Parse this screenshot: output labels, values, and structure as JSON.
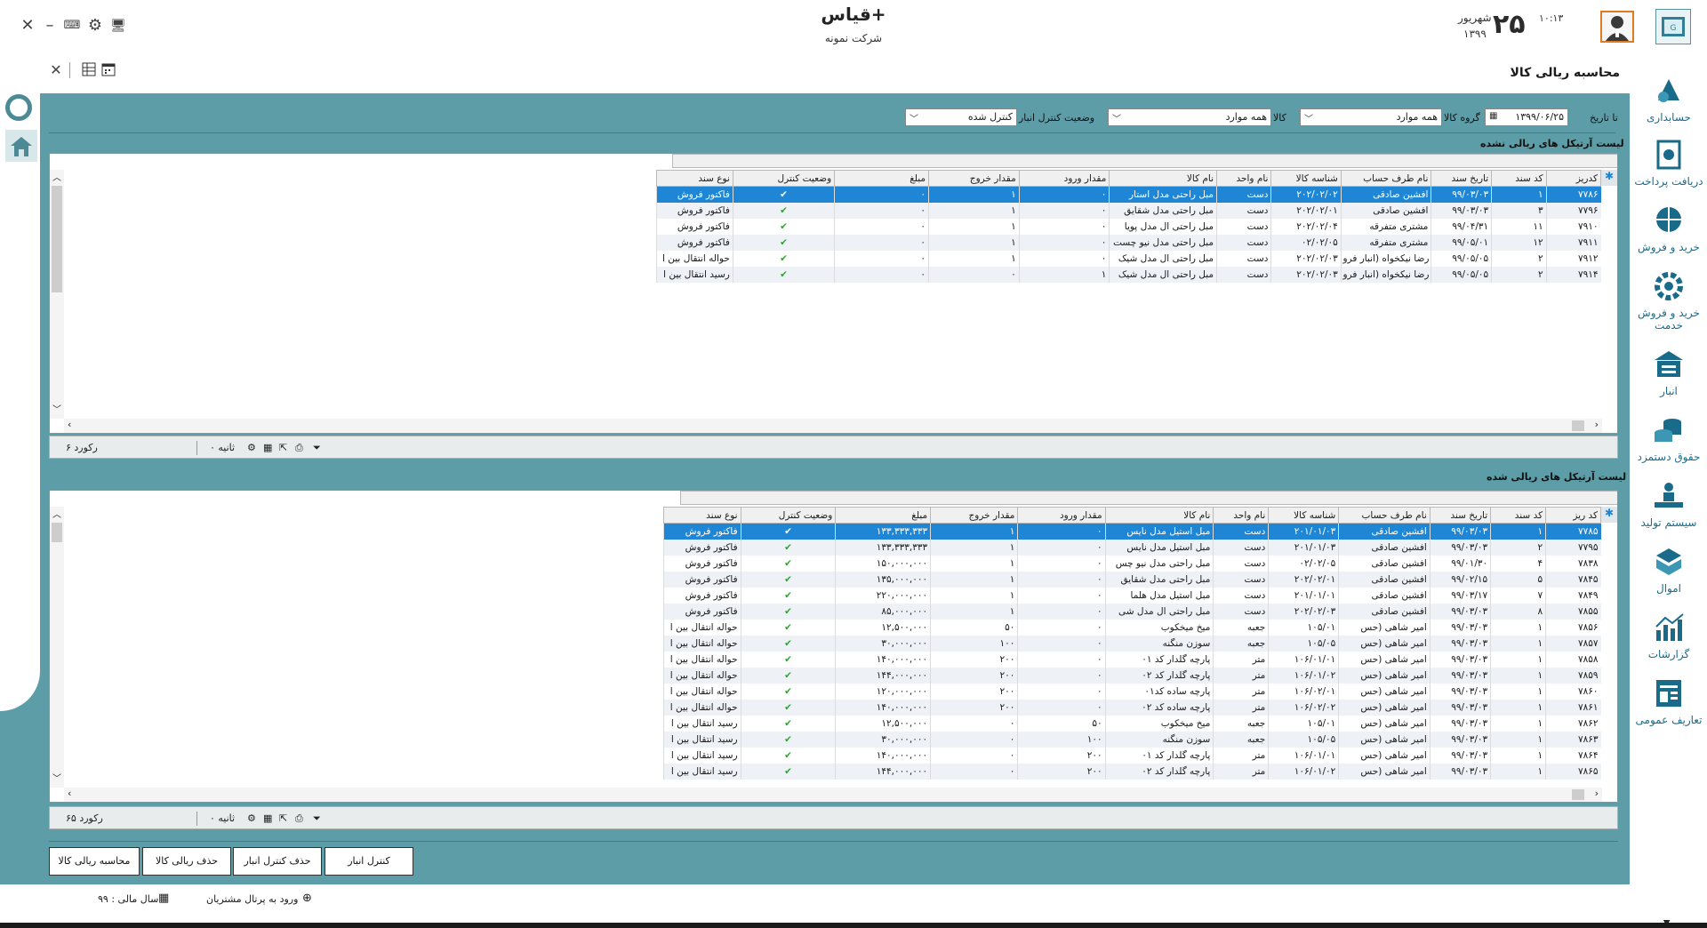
{
  "app": {
    "title": "قیاس+",
    "company": "شرکت نمونه",
    "date_day": "۲۵",
    "date_month": "شهریور",
    "date_year": "۱۳۹۹",
    "clock": "۱۰:۱۳"
  },
  "page": {
    "title": "محاسبه ریالی کالا"
  },
  "filters": {
    "to_date_label": "تا تاریخ",
    "to_date_value": "۱۳۹۹/۰۶/۲۵",
    "group_label": "گروه کالا",
    "group_value": "همه موارد",
    "item_label": "کالا",
    "item_value": "همه موارد",
    "status_label": "وضعیت کنترل انبار",
    "status_value": "کنترل شده"
  },
  "grid1": {
    "title": "لیست آرتیکل های ریالی نشده",
    "columns": [
      "کدریز",
      "کد سند",
      "تاریخ سند",
      "نام طرف حساب",
      "شناسه کالا",
      "نام واحد",
      "نام کالا",
      "مقدار ورود",
      "مقدار خروج",
      "مبلغ",
      "وضعیت کنترل",
      "نوع سند"
    ],
    "rows": [
      [
        "۷۷۸۶",
        "۱",
        "۹۹/۰۳/۰۳",
        "افشین صادقی",
        "۲۰۲/۰۲/۰۲",
        "دست",
        "مبل راحتی مدل استار",
        "۰",
        "۱",
        "۰",
        "✔",
        "فاکتور فروش"
      ],
      [
        "۷۷۹۶",
        "۳",
        "۹۹/۰۳/۰۳",
        "افشین صادقی",
        "۲۰۲/۰۲/۰۱",
        "دست",
        "مبل راحتی مدل شقایق",
        "۰",
        "۱",
        "۰",
        "✔",
        "فاکتور فروش"
      ],
      [
        "۷۹۱۰",
        "۱۱",
        "۹۹/۰۴/۳۱",
        "مشتری متفرقه",
        "۲۰۲/۰۲/۰۴",
        "دست",
        "مبل راحتی ال مدل پویا",
        "۰",
        "۱",
        "۰",
        "✔",
        "فاکتور فروش"
      ],
      [
        "۷۹۱۱",
        "۱۲",
        "۹۹/۰۵/۰۱",
        "مشتری متفرقه",
        "۰۲/۰۲/۰۵",
        "دست",
        "مبل راحتی مدل نیو چست",
        "۰",
        "۱",
        "۰",
        "✔",
        "فاکتور فروش"
      ],
      [
        "۷۹۱۲",
        "۲",
        "۹۹/۰۵/۰۵",
        "رضا نیکخواه (انبار فرو",
        "۲۰۲/۰۲/۰۳",
        "دست",
        "مبل راحتی ال مدل شیک",
        "۰",
        "۱",
        "۰",
        "✔",
        "حواله انتقال بین ا"
      ],
      [
        "۷۹۱۴",
        "۲",
        "۹۹/۰۵/۰۵",
        "رضا نیکخواه (انبار فرو",
        "۲۰۲/۰۲/۰۳",
        "دست",
        "مبل راحتی ال مدل شیک",
        "۱",
        "۰",
        "۰",
        "✔",
        "رسید انتقال بین ا"
      ]
    ],
    "record_count": "۶ رکورد",
    "timer": "۰ ثانیه"
  },
  "grid2": {
    "title": "لیست آرتیکل های ریالی شده",
    "columns": [
      "کد ریز",
      "کد سند",
      "تاریخ سند",
      "نام طرف حساب",
      "شناسه کالا",
      "نام واحد",
      "نام کالا",
      "مقدار ورود",
      "مقدار خروج",
      "مبلغ",
      "وضعیت کنترل",
      "نوع سند"
    ],
    "rows": [
      [
        "۷۷۸۵",
        "۱",
        "۹۹/۰۳/۰۳",
        "افشین صادقی",
        "۲۰۱/۰۱/۰۳",
        "دست",
        "مبل استیل مدل نایس",
        "۰",
        "۱",
        "۱۳۳,۳۳۳,۳۳۳",
        "✔",
        "فاکتور فروش"
      ],
      [
        "۷۷۹۵",
        "۲",
        "۹۹/۰۳/۰۳",
        "افشین صادقی",
        "۲۰۱/۰۱/۰۳",
        "دست",
        "مبل استیل مدل نایس",
        "۰",
        "۱",
        "۱۳۳,۳۳۳,۳۳۳",
        "✔",
        "فاکتور فروش"
      ],
      [
        "۷۸۳۸",
        "۴",
        "۹۹/۰۱/۳۰",
        "افشین صادقی",
        "۰۲/۰۲/۰۵",
        "دست",
        "مبل راحتی مدل نیو چس",
        "۰",
        "۱",
        "۱۵۰,۰۰۰,۰۰۰",
        "✔",
        "فاکتور فروش"
      ],
      [
        "۷۸۴۵",
        "۵",
        "۹۹/۰۲/۱۵",
        "افشین صادقی",
        "۲۰۲/۰۲/۰۱",
        "دست",
        "مبل راحتی مدل شقایق",
        "۰",
        "۱",
        "۱۳۵,۰۰۰,۰۰۰",
        "✔",
        "فاکتور فروش"
      ],
      [
        "۷۸۴۹",
        "۷",
        "۹۹/۰۳/۱۷",
        "افشین صادقی",
        "۲۰۱/۰۱/۰۱",
        "دست",
        "مبل استیل مدل هلما",
        "۰",
        "۱",
        "۲۲۰,۰۰۰,۰۰۰",
        "✔",
        "فاکتور فروش"
      ],
      [
        "۷۸۵۵",
        "۸",
        "۹۹/۰۳/۰۳",
        "افشین صادقی",
        "۲۰۲/۰۲/۰۳",
        "دست",
        "مبل راحتی ال مدل شی",
        "۰",
        "۱",
        "۸۵,۰۰۰,۰۰۰",
        "✔",
        "فاکتور فروش"
      ],
      [
        "۷۸۵۶",
        "۱",
        "۹۹/۰۳/۰۳",
        "امیر شاهی (حس",
        "۱۰۵/۰۱",
        "جعبه",
        "میخ میخکوب",
        "۰",
        "۵۰",
        "۱۲,۵۰۰,۰۰۰",
        "✔",
        "حواله انتقال بین ا"
      ],
      [
        "۷۸۵۷",
        "۱",
        "۹۹/۰۳/۰۳",
        "امیر شاهی (حس",
        "۱۰۵/۰۵",
        "جعبه",
        "سوزن منگنه",
        "۰",
        "۱۰۰",
        "۳۰,۰۰۰,۰۰۰",
        "✔",
        "حواله انتقال بین ا"
      ],
      [
        "۷۸۵۸",
        "۱",
        "۹۹/۰۳/۰۳",
        "امیر شاهی (حس",
        "۱۰۶/۰۱/۰۱",
        "متر",
        "پارچه گلدار کد ۰۱",
        "۰",
        "۲۰۰",
        "۱۴۰,۰۰۰,۰۰۰",
        "✔",
        "حواله انتقال بین ا"
      ],
      [
        "۷۸۵۹",
        "۱",
        "۹۹/۰۳/۰۳",
        "امیر شاهی (حس",
        "۱۰۶/۰۱/۰۲",
        "متر",
        "پارچه گلدار کد ۰۲",
        "۰",
        "۲۰۰",
        "۱۴۴,۰۰۰,۰۰۰",
        "✔",
        "حواله انتقال بین ا"
      ],
      [
        "۷۸۶۰",
        "۱",
        "۹۹/۰۳/۰۳",
        "امیر شاهی (حس",
        "۱۰۶/۰۲/۰۱",
        "متر",
        "پارچه ساده کد۰۱",
        "۰",
        "۲۰۰",
        "۱۲۰,۰۰۰,۰۰۰",
        "✔",
        "حواله انتقال بین ا"
      ],
      [
        "۷۸۶۱",
        "۱",
        "۹۹/۰۳/۰۳",
        "امیر شاهی (حس",
        "۱۰۶/۰۲/۰۲",
        "متر",
        "پارچه ساده کد ۰۲",
        "۰",
        "۲۰۰",
        "۱۴۰,۰۰۰,۰۰۰",
        "✔",
        "حواله انتقال بین ا"
      ],
      [
        "۷۸۶۲",
        "۱",
        "۹۹/۰۳/۰۳",
        "امیر شاهی (حس",
        "۱۰۵/۰۱",
        "جعبه",
        "میخ میخکوب",
        "۵۰",
        "۰",
        "۱۲,۵۰۰,۰۰۰",
        "✔",
        "رسید انتقال بین ا"
      ],
      [
        "۷۸۶۳",
        "۱",
        "۹۹/۰۳/۰۳",
        "امیر شاهی (حس",
        "۱۰۵/۰۵",
        "جعبه",
        "سوزن منگنه",
        "۱۰۰",
        "۰",
        "۳۰,۰۰۰,۰۰۰",
        "✔",
        "رسید انتقال بین ا"
      ],
      [
        "۷۸۶۴",
        "۱",
        "۹۹/۰۳/۰۳",
        "امیر شاهی (حس",
        "۱۰۶/۰۱/۰۱",
        "متر",
        "پارچه گلدار کد ۰۱",
        "۲۰۰",
        "۰",
        "۱۴۰,۰۰۰,۰۰۰",
        "✔",
        "رسید انتقال بین ا"
      ],
      [
        "۷۸۶۵",
        "۱",
        "۹۹/۰۳/۰۳",
        "امیر شاهی (حس",
        "۱۰۶/۰۱/۰۲",
        "متر",
        "پارچه گلدار کد ۰۲",
        "۲۰۰",
        "۰",
        "۱۴۴,۰۰۰,۰۰۰",
        "✔",
        "رسید انتقال بین ا"
      ]
    ],
    "record_count": "۶۵ رکورد",
    "timer": "۰ ثانیه"
  },
  "buttons": {
    "warehouse_control": "کنترل انبار",
    "delete_warehouse_control": "حذف کنترل انبار",
    "delete_rial": "حذف ریالی کالا",
    "compute_rial": "محاسبه ریالی کالا"
  },
  "sidebar": {
    "items": [
      {
        "label": "حسابداری",
        "icon": "accounting-icon"
      },
      {
        "label": "دریافت پرداخت",
        "icon": "payment-icon"
      },
      {
        "label": "خرید و فروش",
        "icon": "sales-icon"
      },
      {
        "label": "خرید و فروش خدمت",
        "icon": "service-sales-icon"
      },
      {
        "label": "انبار",
        "icon": "warehouse-icon"
      },
      {
        "label": "حقوق دستمزد",
        "icon": "payroll-icon"
      },
      {
        "label": "سیستم تولید",
        "icon": "production-icon"
      },
      {
        "label": "اموال",
        "icon": "assets-icon"
      },
      {
        "label": "گزارشات",
        "icon": "reports-icon"
      },
      {
        "label": "تعاریف عمومی",
        "icon": "definitions-icon"
      }
    ]
  },
  "footer": {
    "portal_login": "ورود به پرتال مشتریان",
    "fiscal_year": "سال مالی : ۹۹"
  },
  "colors": {
    "panel": "#5d9da8",
    "selected_row": "#1f86d6",
    "sidebar_text": "#1a6b8a",
    "avatar_border": "#e07b22"
  }
}
